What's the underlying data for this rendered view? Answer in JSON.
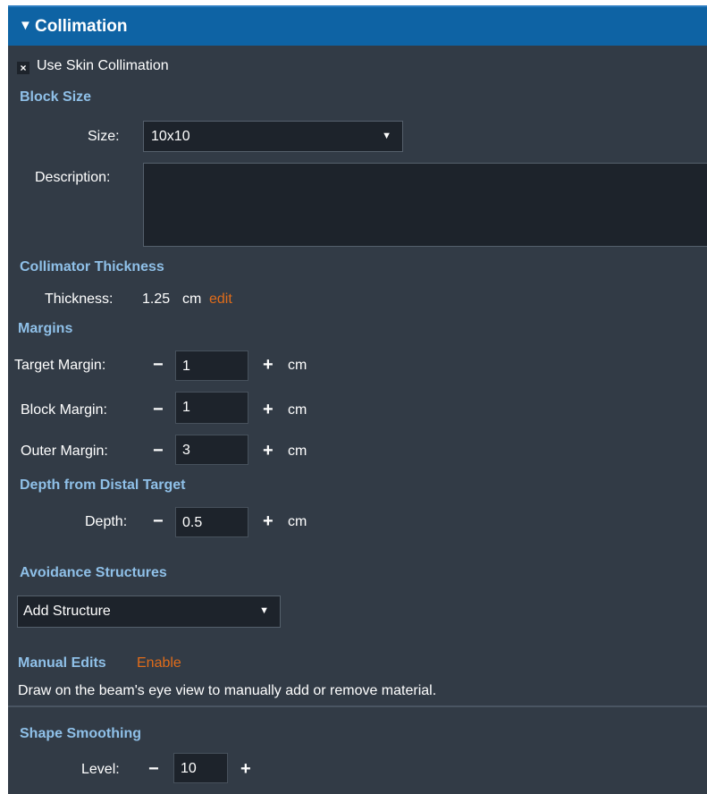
{
  "panel": {
    "title": "Collimation",
    "collapse_glyph": "▼"
  },
  "use_skin": {
    "checked": true,
    "check_glyph": "×",
    "label": "Use Skin Collimation"
  },
  "block_size": {
    "heading": "Block Size",
    "size_label": "Size:",
    "size_value": "10x10",
    "description_label": "Description:",
    "description_value": ""
  },
  "collimator_thickness": {
    "heading": "Collimator Thickness",
    "label": "Thickness:",
    "value": "1.25",
    "unit": "cm",
    "edit_link": "edit"
  },
  "margins": {
    "heading": "Margins",
    "target": {
      "label": "Target Margin:",
      "value": "1",
      "unit": "cm"
    },
    "block": {
      "label": "Block Margin:",
      "value": "1",
      "unit": "cm"
    },
    "outer": {
      "label": "Outer Margin:",
      "value": "3",
      "unit": "cm"
    }
  },
  "depth": {
    "heading": "Depth from Distal Target",
    "label": "Depth:",
    "value": "0.5",
    "unit": "cm"
  },
  "avoidance": {
    "heading": "Avoidance Structures",
    "dropdown_value": "Add Structure"
  },
  "manual_edits": {
    "heading": "Manual Edits",
    "enable_link": "Enable",
    "description": "Draw on the beam's eye view to manually add or remove material."
  },
  "shape_smoothing": {
    "heading": "Shape Smoothing",
    "label": "Level:",
    "value": "10"
  },
  "glyphs": {
    "minus": "−",
    "plus": "+",
    "dropdown_arrow": "▼"
  },
  "colors": {
    "panel_bg": "#323b46",
    "header_bg": "#0e63a4",
    "section_heading": "#8fc0e8",
    "link": "#e06c1a",
    "input_bg": "#1d232b"
  }
}
